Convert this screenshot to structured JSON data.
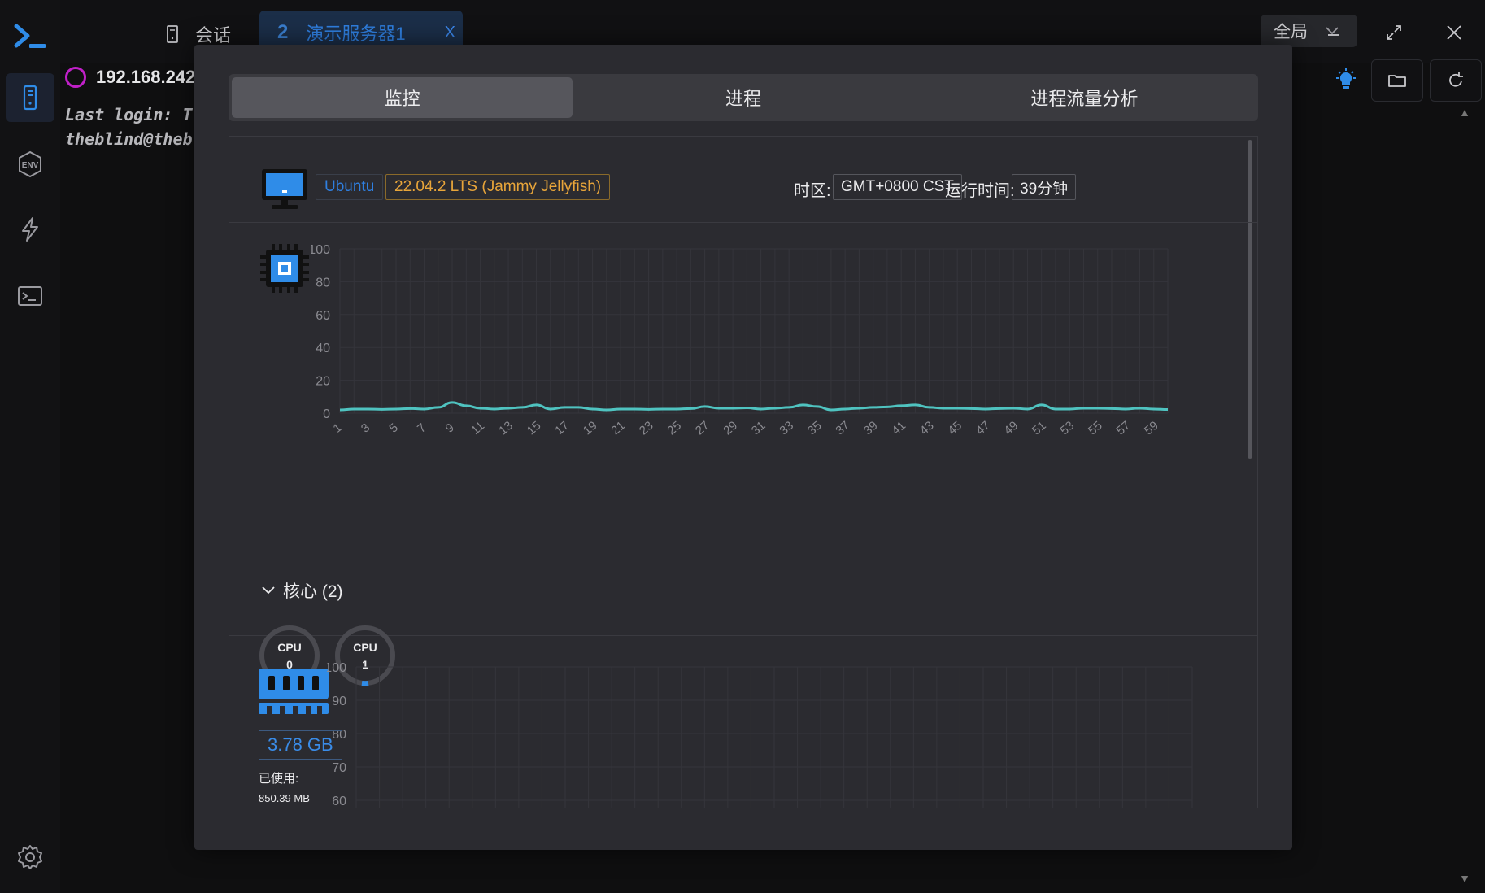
{
  "app": {
    "sessions_label": "会话",
    "active_tab": {
      "number": "2",
      "title": "演示服务器1",
      "close": "X"
    },
    "scope": "全局"
  },
  "terminal": {
    "host": "192.168.242",
    "lines": [
      "Last login: T",
      "theblind@theb"
    ]
  },
  "modal": {
    "tabs": [
      "监控",
      "进程",
      "进程流量分析"
    ],
    "active_tab": 0,
    "system": {
      "os": "Ubuntu",
      "version": "22.04.2 LTS (Jammy Jellyfish)",
      "timezone_label": "时区:",
      "timezone": "GMT+0800 CST",
      "uptime_label": "运行时间:",
      "uptime": "39分钟"
    },
    "cores": {
      "label": "核心 (2)",
      "items": [
        {
          "name": "CPU",
          "id": "0",
          "usage": 3
        },
        {
          "name": "CPU",
          "id": "1",
          "usage": 3
        }
      ]
    },
    "memory": {
      "total": "3.78 GB",
      "used_label": "已使用:",
      "used_value": "850.39 MB"
    }
  },
  "colors": {
    "accent": "#2f7fe0",
    "line": "#4fc3c0",
    "version": "#e8a53a"
  },
  "chart_data": [
    {
      "type": "line",
      "title": "",
      "xlabel": "",
      "ylabel": "",
      "ylim": [
        0,
        100
      ],
      "yticks": [
        0,
        20,
        40,
        60,
        80,
        100
      ],
      "x": [
        1,
        2,
        3,
        4,
        5,
        6,
        7,
        8,
        9,
        10,
        11,
        12,
        13,
        14,
        15,
        16,
        17,
        18,
        19,
        20,
        21,
        22,
        23,
        24,
        25,
        26,
        27,
        28,
        29,
        30,
        31,
        32,
        33,
        34,
        35,
        36,
        37,
        38,
        39,
        40,
        41,
        42,
        43,
        44,
        45,
        46,
        47,
        48,
        49,
        50,
        51,
        52,
        53,
        54,
        55,
        56,
        57,
        58,
        59,
        60
      ],
      "xtick_labels": [
        "1",
        "3",
        "5",
        "7",
        "9",
        "11",
        "13",
        "15",
        "17",
        "19",
        "21",
        "23",
        "25",
        "27",
        "29",
        "31",
        "33",
        "35",
        "37",
        "39",
        "41",
        "43",
        "45",
        "47",
        "49",
        "51",
        "53",
        "55",
        "57",
        "59"
      ],
      "series": [
        {
          "values": [
            2,
            2.5,
            2.5,
            2.3,
            2.5,
            2.8,
            2.5,
            3.5,
            6.5,
            4.5,
            3,
            2.5,
            3,
            3.5,
            5,
            2.5,
            3.5,
            3.5,
            2.5,
            2,
            2.5,
            2.5,
            2.3,
            2.5,
            2.5,
            2.8,
            4,
            3,
            3,
            3.2,
            2.5,
            3,
            3.5,
            5,
            4,
            2,
            2.5,
            3,
            3.5,
            3.8,
            4.5,
            5,
            3.5,
            3,
            3,
            2.8,
            2.5,
            2.8,
            3,
            2.5,
            5,
            2.5,
            2.5,
            3,
            3,
            2.8,
            2.5,
            3,
            2.5,
            2.2
          ]
        }
      ]
    },
    {
      "type": "line",
      "title": "",
      "ylim": [
        60,
        100
      ],
      "yticks": [
        60,
        70,
        80,
        90,
        100
      ],
      "series": []
    }
  ]
}
